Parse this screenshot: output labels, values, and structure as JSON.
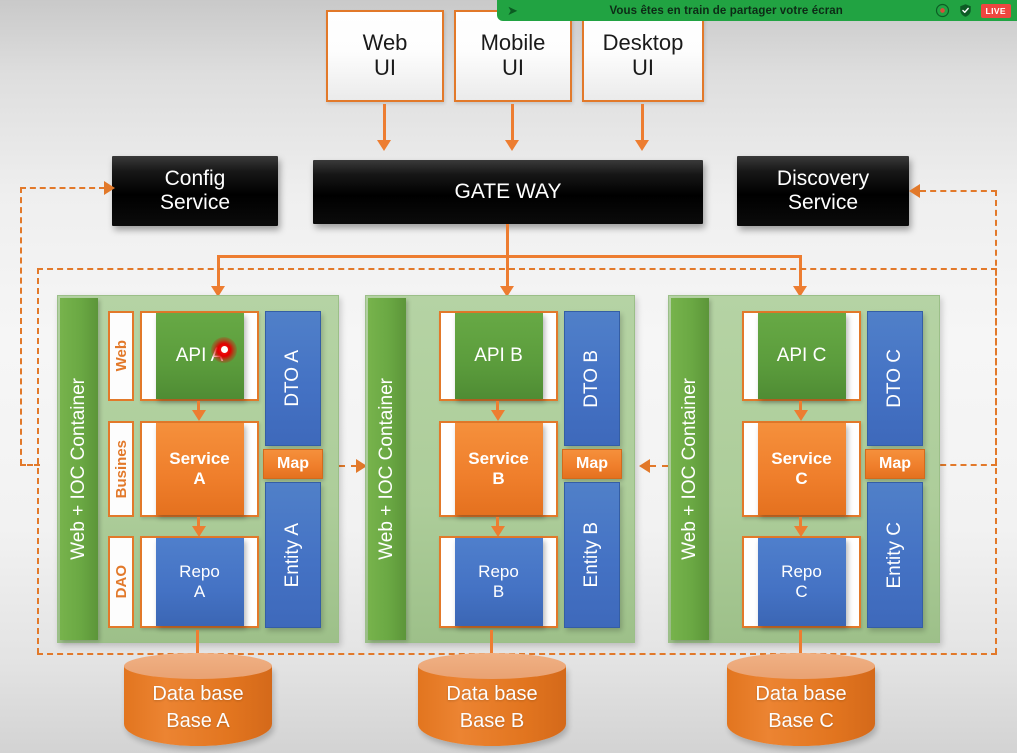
{
  "share_banner": {
    "message": "Vous êtes en train de partager votre écran",
    "cursor_icon": "share-cursor-icon",
    "record_icon": "record-icon",
    "shield_icon": "shield-check-icon",
    "live_label": "LIVE",
    "bg_color": "#21a342",
    "live_color": "#ee4640"
  },
  "clients": [
    {
      "name": "web-ui",
      "line1": "Web",
      "line2": "UI"
    },
    {
      "name": "mobile-ui",
      "line1": "Mobile",
      "line2": "UI"
    },
    {
      "name": "desktop-ui",
      "line1": "Desktop",
      "line2": "UI"
    }
  ],
  "services": {
    "config": {
      "line1": "Config",
      "line2": "Service"
    },
    "gateway": {
      "line1": "GATE WAY",
      "line2": ""
    },
    "discovery": {
      "line1": "Discovery",
      "line2": "Service"
    }
  },
  "containers": [
    {
      "id": "a",
      "ioc_label": "Web + IOC Container",
      "layers": [
        {
          "tag": "Web",
          "show_tag": true
        },
        {
          "tag": "Busines",
          "show_tag": true
        },
        {
          "tag": "DAO",
          "show_tag": true
        }
      ],
      "api": "API A",
      "service_line1": "Service",
      "service_line2": "A",
      "repo_line1": "Repo",
      "repo_line2": "A",
      "dto": "DTO A",
      "map": "Map",
      "entity": "Entity A"
    },
    {
      "id": "b",
      "ioc_label": "Web + IOC Container",
      "layers": [
        {
          "tag": "Web",
          "show_tag": false
        },
        {
          "tag": "Busines",
          "show_tag": false
        },
        {
          "tag": "DAO",
          "show_tag": false
        }
      ],
      "api": "API B",
      "service_line1": "Service",
      "service_line2": "B",
      "repo_line1": "Repo",
      "repo_line2": "B",
      "dto": "DTO B",
      "map": "Map",
      "entity": "Entity B"
    },
    {
      "id": "c",
      "ioc_label": "Web + IOC Container",
      "layers": [
        {
          "tag": "Web",
          "show_tag": false
        },
        {
          "tag": "Busines",
          "show_tag": false
        },
        {
          "tag": "DAO",
          "show_tag": false
        }
      ],
      "api": "API C",
      "service_line1": "Service",
      "service_line2": "C",
      "repo_line1": "Repo",
      "repo_line2": "C",
      "dto": "DTO C",
      "map": "Map",
      "entity": "Entity C"
    }
  ],
  "databases": [
    {
      "line1": "Data base",
      "line2": "Base A"
    },
    {
      "line1": "Data base",
      "line2": "Base B"
    },
    {
      "line1": "Data base",
      "line2": "Base C"
    }
  ],
  "colors": {
    "accent_orange": "#ed7d31",
    "border_orange": "#e2792a",
    "green": "#70ad47",
    "api_green": "#5b9c3c",
    "blue": "#4472c4",
    "container_green": "#adcd9a",
    "black": "#000000",
    "cursor_red": "#e00000"
  }
}
